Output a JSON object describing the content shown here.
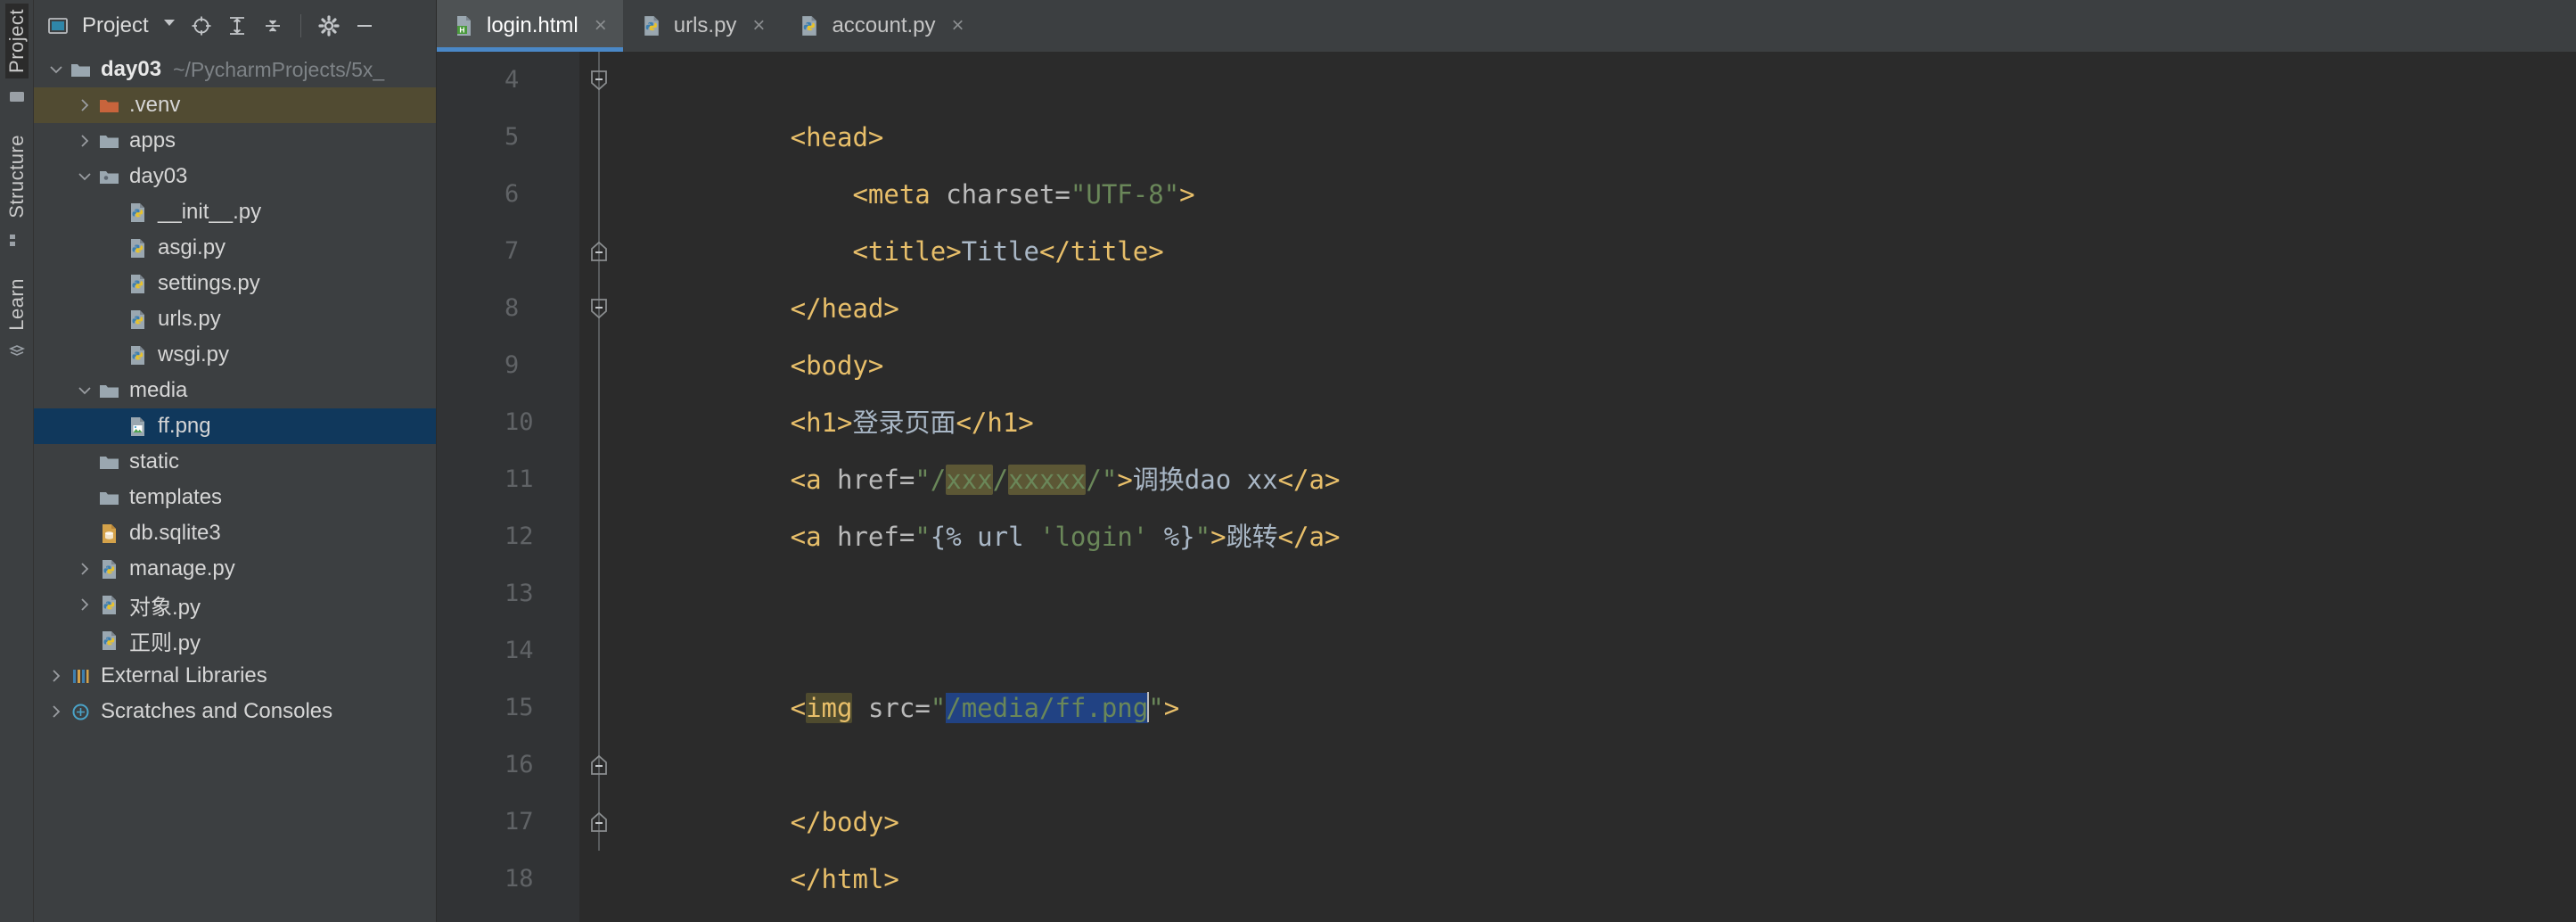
{
  "window": {
    "tool_strip": {
      "tabs": [
        "Project",
        "Structure",
        "Learn"
      ]
    }
  },
  "project_panel": {
    "title": "Project",
    "header_icons": [
      {
        "name": "project-view-icon",
        "glyph": "window"
      },
      {
        "name": "locate-file-icon",
        "glyph": "target"
      },
      {
        "name": "expand-all-icon",
        "glyph": "expand"
      },
      {
        "name": "collapse-all-icon",
        "glyph": "collapse"
      },
      {
        "name": "settings-gear-icon",
        "glyph": "gear"
      },
      {
        "name": "hide-panel-icon",
        "glyph": "minus"
      }
    ],
    "tree": [
      {
        "label": "day03",
        "sub": "~/PycharmProjects/5x_",
        "icon": "folder-root",
        "arrow": "down",
        "indent": 0,
        "bold": true,
        "state": "normal"
      },
      {
        "label": ".venv",
        "sub": "",
        "icon": "folder-excluded",
        "arrow": "right",
        "indent": 1,
        "bold": false,
        "state": "venv-highlight"
      },
      {
        "label": "apps",
        "sub": "",
        "icon": "folder",
        "arrow": "right",
        "indent": 1,
        "bold": false,
        "state": "normal"
      },
      {
        "label": "day03",
        "sub": "",
        "icon": "folder-module",
        "arrow": "down",
        "indent": 1,
        "bold": false,
        "state": "normal"
      },
      {
        "label": "__init__.py",
        "sub": "",
        "icon": "python-file",
        "arrow": "none",
        "indent": 2,
        "bold": false,
        "state": "normal"
      },
      {
        "label": "asgi.py",
        "sub": "",
        "icon": "python-file",
        "arrow": "none",
        "indent": 2,
        "bold": false,
        "state": "normal"
      },
      {
        "label": "settings.py",
        "sub": "",
        "icon": "python-file",
        "arrow": "none",
        "indent": 2,
        "bold": false,
        "state": "normal"
      },
      {
        "label": "urls.py",
        "sub": "",
        "icon": "python-file",
        "arrow": "none",
        "indent": 2,
        "bold": false,
        "state": "normal"
      },
      {
        "label": "wsgi.py",
        "sub": "",
        "icon": "python-file",
        "arrow": "none",
        "indent": 2,
        "bold": false,
        "state": "normal"
      },
      {
        "label": "media",
        "sub": "",
        "icon": "folder",
        "arrow": "down",
        "indent": 1,
        "bold": false,
        "state": "normal"
      },
      {
        "label": "ff.png",
        "sub": "",
        "icon": "image-file",
        "arrow": "none",
        "indent": 2,
        "bold": false,
        "state": "selected"
      },
      {
        "label": "static",
        "sub": "",
        "icon": "folder",
        "arrow": "none",
        "indent": 1,
        "bold": false,
        "state": "normal"
      },
      {
        "label": "templates",
        "sub": "",
        "icon": "folder",
        "arrow": "none",
        "indent": 1,
        "bold": false,
        "state": "normal"
      },
      {
        "label": "db.sqlite3",
        "sub": "",
        "icon": "db-file",
        "arrow": "none",
        "indent": 1,
        "bold": false,
        "state": "normal"
      },
      {
        "label": "manage.py",
        "sub": "",
        "icon": "python-file",
        "arrow": "right",
        "indent": 1,
        "bold": false,
        "state": "normal"
      },
      {
        "label": "对象.py",
        "sub": "",
        "icon": "python-file",
        "arrow": "right",
        "indent": 1,
        "bold": false,
        "state": "normal"
      },
      {
        "label": "正则.py",
        "sub": "",
        "icon": "python-file",
        "arrow": "none",
        "indent": 1,
        "bold": false,
        "state": "normal"
      },
      {
        "label": "External Libraries",
        "sub": "",
        "icon": "libraries",
        "arrow": "right",
        "indent": 0,
        "bold": false,
        "state": "normal"
      },
      {
        "label": "Scratches and Consoles",
        "sub": "",
        "icon": "scratches",
        "arrow": "right",
        "indent": 0,
        "bold": false,
        "state": "normal"
      }
    ]
  },
  "editor": {
    "tabs": [
      {
        "label": "login.html",
        "icon": "html-file-icon",
        "active": true,
        "close": "×"
      },
      {
        "label": "urls.py",
        "icon": "python-file-icon",
        "active": false,
        "close": "×"
      },
      {
        "label": "account.py",
        "icon": "python-file-icon",
        "active": false,
        "close": "×"
      }
    ],
    "line_numbers": [
      "4",
      "5",
      "6",
      "7",
      "8",
      "9",
      "10",
      "11",
      "12",
      "13",
      "14",
      "15",
      "16",
      "17",
      "18"
    ],
    "lines": [
      {
        "n": "4",
        "fold": "start",
        "text": "<head>"
      },
      {
        "n": "5",
        "fold": "none",
        "text": "    <meta charset=\"UTF-8\">"
      },
      {
        "n": "6",
        "fold": "none",
        "text": "    <title>Title</title>"
      },
      {
        "n": "7",
        "fold": "end",
        "text": "</head>"
      },
      {
        "n": "8",
        "fold": "start",
        "text": "<body>"
      },
      {
        "n": "9",
        "fold": "none",
        "text": "<h1>登录页面</h1>"
      },
      {
        "n": "10",
        "fold": "none",
        "text": "<a href=\"/xxx/xxxxx/\">调换dao xx</a>"
      },
      {
        "n": "11",
        "fold": "none",
        "text": "<a href=\"{% url 'login' %}\">跳转</a>"
      },
      {
        "n": "12",
        "fold": "none",
        "text": ""
      },
      {
        "n": "13",
        "fold": "none",
        "text": ""
      },
      {
        "n": "14",
        "fold": "none",
        "text": "<img src=\"/media/ff.png\">"
      },
      {
        "n": "15",
        "fold": "none",
        "text": ""
      },
      {
        "n": "16",
        "fold": "end",
        "text": "</body>"
      },
      {
        "n": "17",
        "fold": "end",
        "text": "</html>"
      },
      {
        "n": "18",
        "fold": "none",
        "text": ""
      }
    ],
    "tokens": {
      "head_open": "<head>",
      "meta_tag_open": "<meta ",
      "meta_attr": "charset=",
      "meta_value": "\"UTF-8\"",
      "meta_tag_close": ">",
      "title_open": "<title>",
      "title_text": "Title",
      "title_close": "</title>",
      "head_close": "</head>",
      "body_open": "<body>",
      "h1_open": "<h1>",
      "h1_text": "登录页面",
      "h1_close": "</h1>",
      "a10_open": "<a ",
      "a10_attr": "href=",
      "a10_q1": "\"/",
      "a10_hl1": "xxx",
      "a10_slash": "/",
      "a10_hl2": "xxxxx",
      "a10_tail": "/\"",
      "a10_gt": ">",
      "a10_text": "调换dao xx",
      "a10_close": "</a>",
      "a11_open": "<a ",
      "a11_attr": "href=",
      "a11_q1": "\"",
      "a11_dj1": "{% ",
      "a11_dj2": "url ",
      "a11_dj3": "'login'",
      "a11_dj4": " %}",
      "a11_q2": "\"",
      "a11_gt": ">",
      "a11_text": "跳转",
      "a11_close": "</a>",
      "img_lt": "<",
      "img_tagname": "img",
      "img_space": " ",
      "img_attr": "src=",
      "img_q1": "\"",
      "img_value": "/media/ff.png",
      "img_q2": "\"",
      "img_gt": ">",
      "body_close": "</body>",
      "html_close": "</html>"
    }
  },
  "colors": {
    "tag": "#e8bf6a",
    "string": "#6a8759",
    "text": "#a9b7c6",
    "django": "#9876aa",
    "find_highlight": "#5c5735",
    "selection": "#214283",
    "tab_underline": "#4a88c7",
    "tree_selection": "#10385c",
    "venv_highlight": "#514b32",
    "editor_bg": "#2b2b2b",
    "panel_bg": "#3c3f41"
  }
}
